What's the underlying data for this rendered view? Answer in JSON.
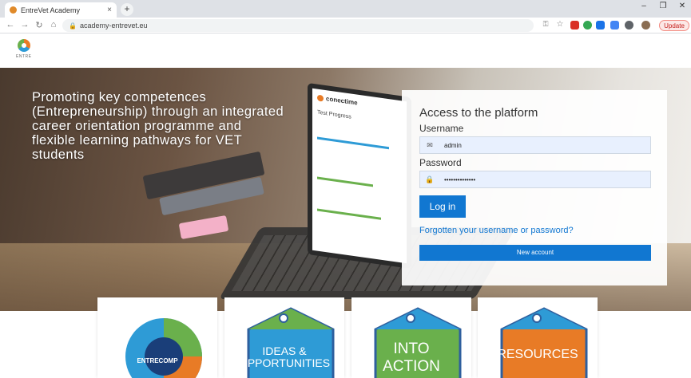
{
  "browser": {
    "tab_title": "EntreVet Academy",
    "tab_close": "×",
    "new_tab": "+",
    "url": "academy-entrevet.eu",
    "update_label": "Update",
    "win_min": "–",
    "win_max": "❐",
    "win_close": "✕"
  },
  "site": {
    "logo_text": "ENTRE"
  },
  "hero": {
    "tagline": "Promoting key competences (Entrepreneurship) through an integrated career orientation programme and flexible learning pathways for VET students",
    "screen_brand": "conectime",
    "screen_title": "Test Progress"
  },
  "login": {
    "heading": "Access to the platform",
    "username_label": "Username",
    "username_value": "admin",
    "password_label": "Password",
    "password_value": "••••••••••••••",
    "login_button": "Log in",
    "forgot_link": "Forgotten your username or password?",
    "new_account_button": "New account"
  },
  "cards": [
    {
      "label": "ENTRECOMP",
      "color": "#2e9bd6"
    },
    {
      "label": "IDEAS & OPPORTUNITIES",
      "color": "#2e9bd6"
    },
    {
      "label": "INTO ACTION",
      "color": "#6ab04c"
    },
    {
      "label": "RESOURCES",
      "color": "#e87b26"
    }
  ],
  "colors": {
    "accent": "#1177d1",
    "hex_border": "#2e5f9e"
  }
}
